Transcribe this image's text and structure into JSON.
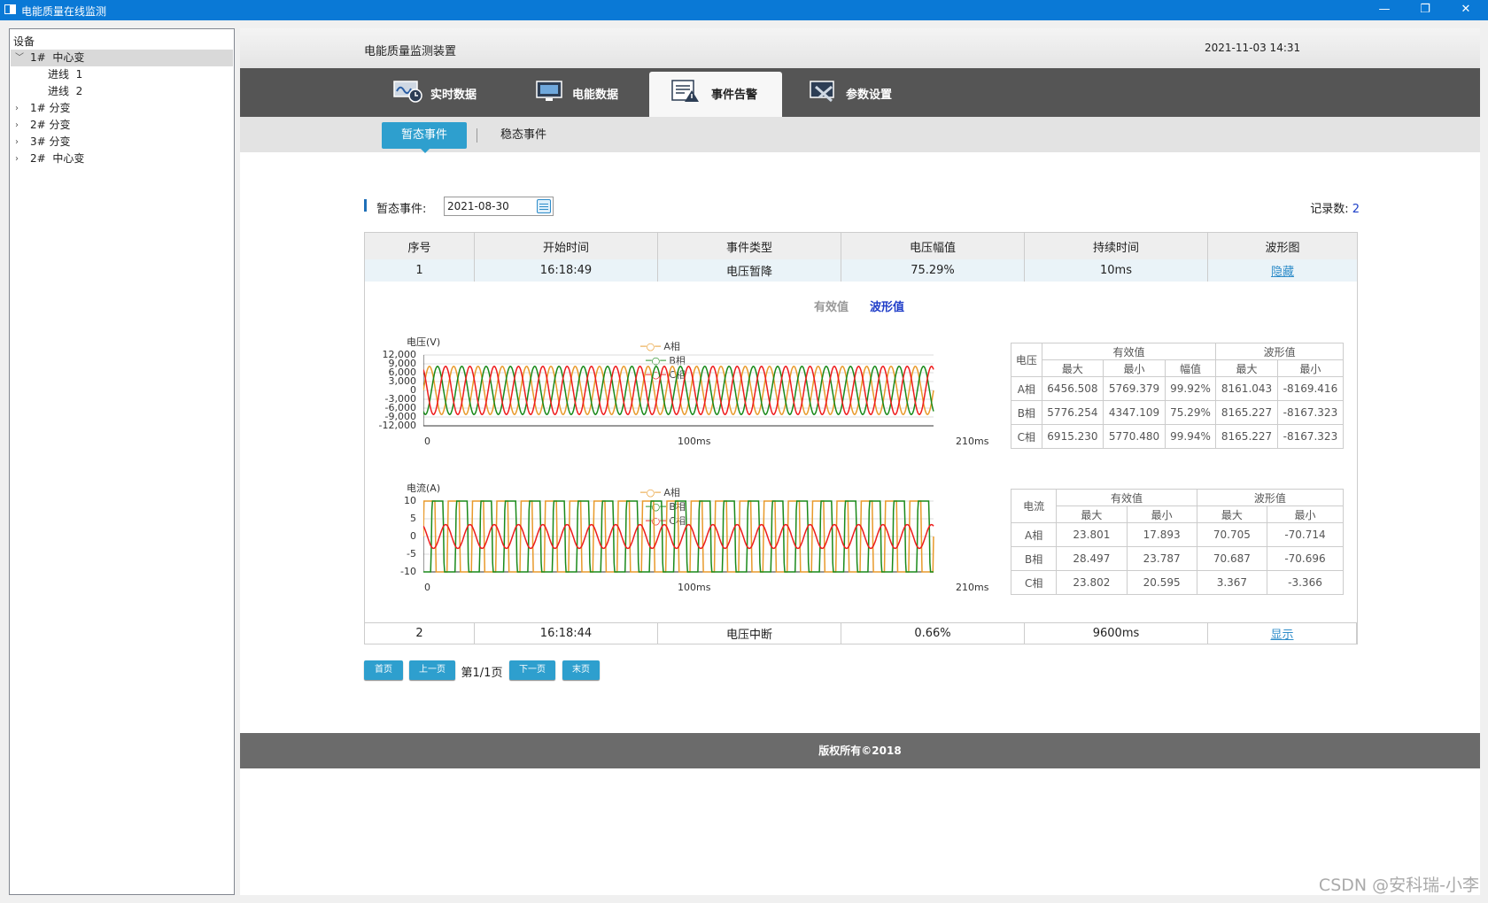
{
  "window": {
    "title": "电能质量在线监测",
    "min": "—",
    "restore": "❐",
    "close": "✕"
  },
  "tree": {
    "header": "设备",
    "nodes": [
      {
        "label": "1#  中心变",
        "expanded": true,
        "selected": true
      },
      {
        "label": "进线  1",
        "child": true
      },
      {
        "label": "进线  2",
        "child": true
      },
      {
        "label": "1# 分变"
      },
      {
        "label": "2# 分变"
      },
      {
        "label": "3# 分变"
      },
      {
        "label": "2#  中心变"
      }
    ]
  },
  "header": {
    "device_name": "电能质量监测装置",
    "datetime": "2021-11-03 14:31"
  },
  "nav": {
    "tabs": [
      "实时数据",
      "电能数据",
      "事件告警",
      "参数设置"
    ],
    "active_index": 2
  },
  "subnav": {
    "tabs": [
      "暂态事件",
      "稳态事件"
    ],
    "active_index": 0
  },
  "filter": {
    "label": "暂态事件:",
    "date": "2021-08-30",
    "count_label": "记录数:",
    "count": "2"
  },
  "table": {
    "columns": [
      "序号",
      "开始时间",
      "事件类型",
      "电压幅值",
      "持续时间",
      "波形图"
    ],
    "rows": [
      {
        "no": "1",
        "start": "16:18:49",
        "type": "电压暂降",
        "amplitude": "75.29%",
        "duration": "10ms",
        "action": "隐藏"
      },
      {
        "no": "2",
        "start": "16:18:44",
        "type": "电压中断",
        "amplitude": "0.66%",
        "duration": "9600ms",
        "action": "显示"
      }
    ]
  },
  "detail": {
    "toggle_rms": "有效值",
    "toggle_wave": "波形值",
    "legend": [
      "A相",
      "B相",
      "C相"
    ],
    "legend_colors": [
      "#e89a2b",
      "#1a8a1a",
      "#ee1c1c"
    ],
    "voltage_chart": {
      "ylabel": "电压(V)",
      "yticks": [
        "12,000",
        "9,000",
        "6,000",
        "3,000",
        "0",
        "-3,000",
        "-6,000",
        "-9,000",
        "-12,000"
      ],
      "xticks": [
        "0",
        "100ms",
        "210ms"
      ],
      "ylim": [
        -12000,
        12000
      ],
      "xlim": [
        0,
        210
      ]
    },
    "current_chart": {
      "ylabel": "电流(A)",
      "yticks": [
        "10",
        "5",
        "0",
        "-5",
        "-10"
      ],
      "xticks": [
        "0",
        "100ms",
        "210ms"
      ],
      "ylim": [
        -10,
        10
      ],
      "xlim": [
        0,
        210
      ]
    },
    "voltage_stats": {
      "corner": "电压",
      "group1": "有效值",
      "group2": "波形值",
      "sub": [
        "最大",
        "最小",
        "幅值",
        "最大",
        "最小"
      ],
      "rows": [
        [
          "A相",
          "6456.508",
          "5769.379",
          "99.92%",
          "8161.043",
          "-8169.416"
        ],
        [
          "B相",
          "5776.254",
          "4347.109",
          "75.29%",
          "8165.227",
          "-8167.323"
        ],
        [
          "C相",
          "6915.230",
          "5770.480",
          "99.94%",
          "8165.227",
          "-8167.323"
        ]
      ]
    },
    "current_stats": {
      "corner": "电流",
      "group1": "有效值",
      "group2": "波形值",
      "sub": [
        "最大",
        "最小",
        "最大",
        "最小"
      ],
      "rows": [
        [
          "A相",
          "23.801",
          "17.893",
          "70.705",
          "-70.714"
        ],
        [
          "B相",
          "28.497",
          "23.787",
          "70.687",
          "-70.696"
        ],
        [
          "C相",
          "23.802",
          "20.595",
          "3.367",
          "-3.366"
        ]
      ]
    }
  },
  "chart_data": [
    {
      "type": "line",
      "title": "",
      "ylabel": "电压(V)",
      "xlabel": "",
      "x_range_ms": [
        0,
        210
      ],
      "ylim": [
        -12000,
        12000
      ],
      "series": [
        {
          "name": "A相",
          "amplitude": 8161,
          "frequency_hz": 100,
          "phase_deg": 0
        },
        {
          "name": "B相",
          "amplitude": 8165,
          "frequency_hz": 100,
          "phase_deg": -120
        },
        {
          "name": "C相",
          "amplitude": 8165,
          "frequency_hz": 100,
          "phase_deg": 120
        }
      ],
      "legend": "top-center",
      "grid": true
    },
    {
      "type": "line",
      "title": "",
      "ylabel": "电流(A)",
      "xlabel": "",
      "x_range_ms": [
        0,
        210
      ],
      "ylim": [
        -10,
        10
      ],
      "series": [
        {
          "name": "A相",
          "amplitude": 70.7,
          "frequency_hz": 100,
          "phase_deg": 0
        },
        {
          "name": "B相",
          "amplitude": 70.7,
          "frequency_hz": 100,
          "phase_deg": -120
        },
        {
          "name": "C相",
          "amplitude": 3.367,
          "frequency_hz": 100,
          "phase_deg": 120
        }
      ],
      "legend": "top-center",
      "grid": true
    }
  ],
  "pager": {
    "first": "首页",
    "prev": "上一页",
    "info": "第1/1页",
    "next": "下一页",
    "last": "末页"
  },
  "footer": "版权所有©2018",
  "watermark": "CSDN @安科瑞-小李"
}
